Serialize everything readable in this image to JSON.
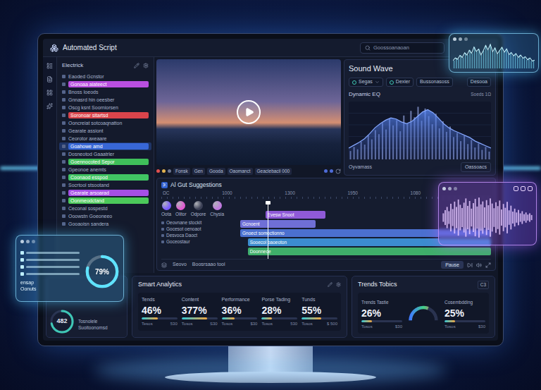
{
  "window": {
    "title": "Automated Script"
  },
  "header": {
    "search_placeholder": "Goossoanaoan"
  },
  "sidebar": {
    "title": "Electrick",
    "items": [
      {
        "label": "Eaoded Gcnstor",
        "selected": false
      },
      {
        "label": "Gonoaa aiateect",
        "selected": false,
        "color": "#b94fe0"
      },
      {
        "label": "Bnoss Ioeods",
        "selected": false
      },
      {
        "label": "Gnnasrd hin oeesber",
        "selected": false
      },
      {
        "label": "Oscg ksnt Soorniorsen",
        "selected": false
      },
      {
        "label": "Soronoar sitartsd",
        "selected": false,
        "color": "#d9444b"
      },
      {
        "label": "Ooncreiat sotcoaqnatton",
        "selected": false
      },
      {
        "label": "Gearate assiont",
        "selected": false
      },
      {
        "label": "Ceorotor axeaare",
        "selected": false
      },
      {
        "label": "Goahowe amd",
        "selected": true,
        "color": "#3867d6"
      },
      {
        "label": "Dosneotod Gaaatrler",
        "selected": false
      },
      {
        "label": "Goennocoted Sepor",
        "selected": false,
        "color": "#3fbf5a"
      },
      {
        "label": "Gpeonoe anemts",
        "selected": false
      },
      {
        "label": "Coonaod esspod",
        "selected": false,
        "color": "#41c463"
      },
      {
        "label": "Socrtool stsootand",
        "selected": false
      },
      {
        "label": "Gearate arsoarad",
        "selected": false,
        "color": "#a64fe6"
      },
      {
        "label": "Oonmeodctand",
        "selected": false,
        "color": "#4cc95a"
      },
      {
        "label": "Ceconal sospestd",
        "selected": false
      },
      {
        "label": "Ooowstn Goeoneeo",
        "selected": false
      },
      {
        "label": "Gooaoisn sandera",
        "selected": false
      }
    ]
  },
  "video": {
    "controls": [
      "Fonsk",
      "Gen",
      "Gooda",
      "Oaomanct",
      "Geaclebacil 000"
    ]
  },
  "sound_wave": {
    "title": "Sound Wave",
    "selectors": [
      {
        "label": "Segas",
        "kind": "dropdown"
      },
      {
        "label": "Dexier",
        "kind": "toggle"
      },
      {
        "label": "Bussonasoss",
        "kind": "button"
      },
      {
        "label": "Desooa",
        "kind": "button"
      }
    ],
    "chart": {
      "title": "Dynamic EQ",
      "note": "Soeds 1Ω",
      "curve": [
        2,
        2.5,
        3,
        3.6,
        4.5,
        5.5,
        6.2,
        6.8,
        7.2,
        7,
        6.5,
        6.2,
        6.6,
        7.4,
        8.2,
        8.6,
        8.1,
        7.2,
        6.2,
        5.5,
        5,
        4.6,
        4.2,
        3.8,
        3.2,
        2.8,
        2.4,
        2
      ],
      "spikes": [
        1.5,
        2.2,
        1.8,
        3.1,
        2.6,
        4.2,
        3.5,
        5.1,
        4.4,
        6.3,
        5.2,
        7.1,
        5.9,
        6.8,
        4.9,
        7.6,
        6.2,
        8.4,
        7.3,
        9.1,
        6.7,
        8.8,
        7.5,
        6.1,
        7.9,
        5.4,
        6.6,
        4.8,
        5.7,
        3.9,
        4.6,
        3.2,
        4.1,
        2.7,
        3.4,
        2.1,
        2.8,
        1.7,
        2.2,
        1.4
      ]
    },
    "footer_label": "Oyvamass",
    "footer_button": "Oassoacs"
  },
  "timeline": {
    "title": "Al Gut Suggestions",
    "ruler": [
      "ΩC",
      "1000",
      "1300",
      "1950",
      "1080"
    ],
    "swatches": [
      {
        "label": "Oota",
        "color": "#7a5cff"
      },
      {
        "label": "Olitor",
        "color": "#e05ad0"
      },
      {
        "label": "Odpore",
        "color": "#3a3f55"
      },
      {
        "label": "Chysia",
        "color": "#c07ae0"
      }
    ],
    "clip_labels": [
      "Oeovnane stockit",
      "Gocesot oenoaot",
      "Desvoca Daoct",
      "Goceostaur"
    ],
    "playhead": 0.11,
    "tracks": [
      {
        "clips": [
          {
            "label": "Evesw Snoot",
            "start": 0.1,
            "end": 0.34,
            "color": "#8f5ad8"
          }
        ]
      },
      {
        "clips": [
          {
            "label": "Gcnoent",
            "start": 0.0,
            "end": 0.3,
            "color": "#6f6fd6"
          }
        ]
      },
      {
        "clips": [
          {
            "label": "Gnoect somoctionno",
            "start": 0.0,
            "end": 1.0,
            "color": "#4b70cf"
          }
        ]
      },
      {
        "clips": [
          {
            "label": "Sooecol oaoeoton",
            "start": 0.03,
            "end": 1.0,
            "color": "#3c8ccf"
          }
        ]
      },
      {
        "clips": [
          {
            "label": "Doonneoe",
            "start": 0.03,
            "end": 1.0,
            "color": "#3fae6a"
          }
        ]
      }
    ],
    "footer": [
      "Seovo",
      "Boosrsaao tool"
    ],
    "pause_label": "Pause"
  },
  "analytics": {
    "title": "Smart Analytics",
    "stats": [
      {
        "label": "Tends",
        "value": "46%",
        "level": 0.46,
        "note": "Tesos",
        "amount": "530"
      },
      {
        "label": "Content",
        "value": "377%",
        "level": 0.72,
        "note": "Tosos",
        "amount": "S30"
      },
      {
        "label": "Performance",
        "value": "36%",
        "level": 0.36,
        "note": "Tosos",
        "amount": "$30"
      },
      {
        "label": "Porse Tading",
        "value": "28%",
        "level": 0.28,
        "note": "Tosos",
        "amount": "530"
      },
      {
        "label": "Tunds",
        "value": "55%",
        "level": 0.55,
        "note": "Tosos",
        "amount": "$ 500"
      }
    ]
  },
  "trends": {
    "title": "Trends Tobics",
    "badge": "C3",
    "metrics": [
      {
        "label": "Trends Tastie",
        "value": "26%",
        "level": 0.26,
        "note": "Tosos",
        "amount": "$30"
      },
      {
        "label": "Cosembdding",
        "value": "25%",
        "level": 0.25,
        "note": "Tosos",
        "amount": "$30"
      }
    ],
    "gauge": {
      "level": 0.62
    }
  },
  "mini_panel": {
    "value": "482",
    "level": 0.72,
    "lines": [
      "Tosnolele",
      "Suoitoonomsd"
    ]
  },
  "overlays": {
    "eq_window": {
      "values": [
        3,
        4,
        3.5,
        5,
        4.2,
        6,
        5.1,
        7,
        5.8,
        8.2,
        6.5,
        7.4,
        5.2,
        6.8,
        8.8,
        7.1,
        9.2,
        6.4,
        7.9,
        5.6,
        6.9,
        8.1,
        6.2,
        7.5,
        5.3,
        6.1,
        4.8,
        5.7,
        4.2,
        5.1,
        3.9,
        4.5,
        3.3,
        4,
        2.8,
        3.2
      ]
    },
    "wave_window": {
      "values": [
        2,
        3.5,
        5,
        3,
        6.5,
        4,
        7.5,
        5,
        8.5,
        6,
        4.5,
        7,
        9,
        5.5,
        7.8,
        4.2,
        6.8,
        8.8,
        5.2,
        9.4,
        6.2,
        7.6,
        4.8,
        8.2,
        5.8,
        9,
        6.6,
        4.4,
        7.2,
        5.4,
        8,
        3.8,
        6.4,
        4.6,
        7.4,
        3.4,
        5.6,
        2.8,
        4.2,
        2.4,
        3.6,
        2,
        3,
        1.6,
        2.4,
        1.4,
        2,
        1.2
      ]
    },
    "progress_window": {
      "value": "79%",
      "level": 0.79,
      "labels": [
        "ensap",
        "Oonuts"
      ]
    }
  }
}
